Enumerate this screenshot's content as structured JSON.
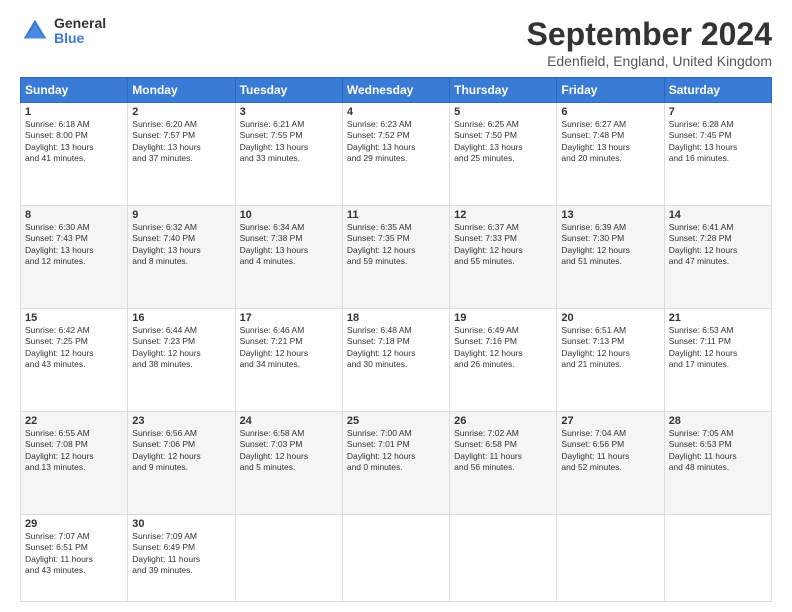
{
  "logo": {
    "general": "General",
    "blue": "Blue"
  },
  "title": {
    "month_year": "September 2024",
    "location": "Edenfield, England, United Kingdom"
  },
  "headers": [
    "Sunday",
    "Monday",
    "Tuesday",
    "Wednesday",
    "Thursday",
    "Friday",
    "Saturday"
  ],
  "weeks": [
    [
      {
        "day": "1",
        "info": "Sunrise: 6:18 AM\nSunset: 8:00 PM\nDaylight: 13 hours\nand 41 minutes."
      },
      {
        "day": "2",
        "info": "Sunrise: 6:20 AM\nSunset: 7:57 PM\nDaylight: 13 hours\nand 37 minutes."
      },
      {
        "day": "3",
        "info": "Sunrise: 6:21 AM\nSunset: 7:55 PM\nDaylight: 13 hours\nand 33 minutes."
      },
      {
        "day": "4",
        "info": "Sunrise: 6:23 AM\nSunset: 7:52 PM\nDaylight: 13 hours\nand 29 minutes."
      },
      {
        "day": "5",
        "info": "Sunrise: 6:25 AM\nSunset: 7:50 PM\nDaylight: 13 hours\nand 25 minutes."
      },
      {
        "day": "6",
        "info": "Sunrise: 6:27 AM\nSunset: 7:48 PM\nDaylight: 13 hours\nand 20 minutes."
      },
      {
        "day": "7",
        "info": "Sunrise: 6:28 AM\nSunset: 7:45 PM\nDaylight: 13 hours\nand 16 minutes."
      }
    ],
    [
      {
        "day": "8",
        "info": "Sunrise: 6:30 AM\nSunset: 7:43 PM\nDaylight: 13 hours\nand 12 minutes."
      },
      {
        "day": "9",
        "info": "Sunrise: 6:32 AM\nSunset: 7:40 PM\nDaylight: 13 hours\nand 8 minutes."
      },
      {
        "day": "10",
        "info": "Sunrise: 6:34 AM\nSunset: 7:38 PM\nDaylight: 13 hours\nand 4 minutes."
      },
      {
        "day": "11",
        "info": "Sunrise: 6:35 AM\nSunset: 7:35 PM\nDaylight: 12 hours\nand 59 minutes."
      },
      {
        "day": "12",
        "info": "Sunrise: 6:37 AM\nSunset: 7:33 PM\nDaylight: 12 hours\nand 55 minutes."
      },
      {
        "day": "13",
        "info": "Sunrise: 6:39 AM\nSunset: 7:30 PM\nDaylight: 12 hours\nand 51 minutes."
      },
      {
        "day": "14",
        "info": "Sunrise: 6:41 AM\nSunset: 7:28 PM\nDaylight: 12 hours\nand 47 minutes."
      }
    ],
    [
      {
        "day": "15",
        "info": "Sunrise: 6:42 AM\nSunset: 7:25 PM\nDaylight: 12 hours\nand 43 minutes."
      },
      {
        "day": "16",
        "info": "Sunrise: 6:44 AM\nSunset: 7:23 PM\nDaylight: 12 hours\nand 38 minutes."
      },
      {
        "day": "17",
        "info": "Sunrise: 6:46 AM\nSunset: 7:21 PM\nDaylight: 12 hours\nand 34 minutes."
      },
      {
        "day": "18",
        "info": "Sunrise: 6:48 AM\nSunset: 7:18 PM\nDaylight: 12 hours\nand 30 minutes."
      },
      {
        "day": "19",
        "info": "Sunrise: 6:49 AM\nSunset: 7:16 PM\nDaylight: 12 hours\nand 26 minutes."
      },
      {
        "day": "20",
        "info": "Sunrise: 6:51 AM\nSunset: 7:13 PM\nDaylight: 12 hours\nand 21 minutes."
      },
      {
        "day": "21",
        "info": "Sunrise: 6:53 AM\nSunset: 7:11 PM\nDaylight: 12 hours\nand 17 minutes."
      }
    ],
    [
      {
        "day": "22",
        "info": "Sunrise: 6:55 AM\nSunset: 7:08 PM\nDaylight: 12 hours\nand 13 minutes."
      },
      {
        "day": "23",
        "info": "Sunrise: 6:56 AM\nSunset: 7:06 PM\nDaylight: 12 hours\nand 9 minutes."
      },
      {
        "day": "24",
        "info": "Sunrise: 6:58 AM\nSunset: 7:03 PM\nDaylight: 12 hours\nand 5 minutes."
      },
      {
        "day": "25",
        "info": "Sunrise: 7:00 AM\nSunset: 7:01 PM\nDaylight: 12 hours\nand 0 minutes."
      },
      {
        "day": "26",
        "info": "Sunrise: 7:02 AM\nSunset: 6:58 PM\nDaylight: 11 hours\nand 56 minutes."
      },
      {
        "day": "27",
        "info": "Sunrise: 7:04 AM\nSunset: 6:56 PM\nDaylight: 11 hours\nand 52 minutes."
      },
      {
        "day": "28",
        "info": "Sunrise: 7:05 AM\nSunset: 6:53 PM\nDaylight: 11 hours\nand 48 minutes."
      }
    ],
    [
      {
        "day": "29",
        "info": "Sunrise: 7:07 AM\nSunset: 6:51 PM\nDaylight: 11 hours\nand 43 minutes."
      },
      {
        "day": "30",
        "info": "Sunrise: 7:09 AM\nSunset: 6:49 PM\nDaylight: 11 hours\nand 39 minutes."
      },
      {
        "day": "",
        "info": ""
      },
      {
        "day": "",
        "info": ""
      },
      {
        "day": "",
        "info": ""
      },
      {
        "day": "",
        "info": ""
      },
      {
        "day": "",
        "info": ""
      }
    ]
  ]
}
